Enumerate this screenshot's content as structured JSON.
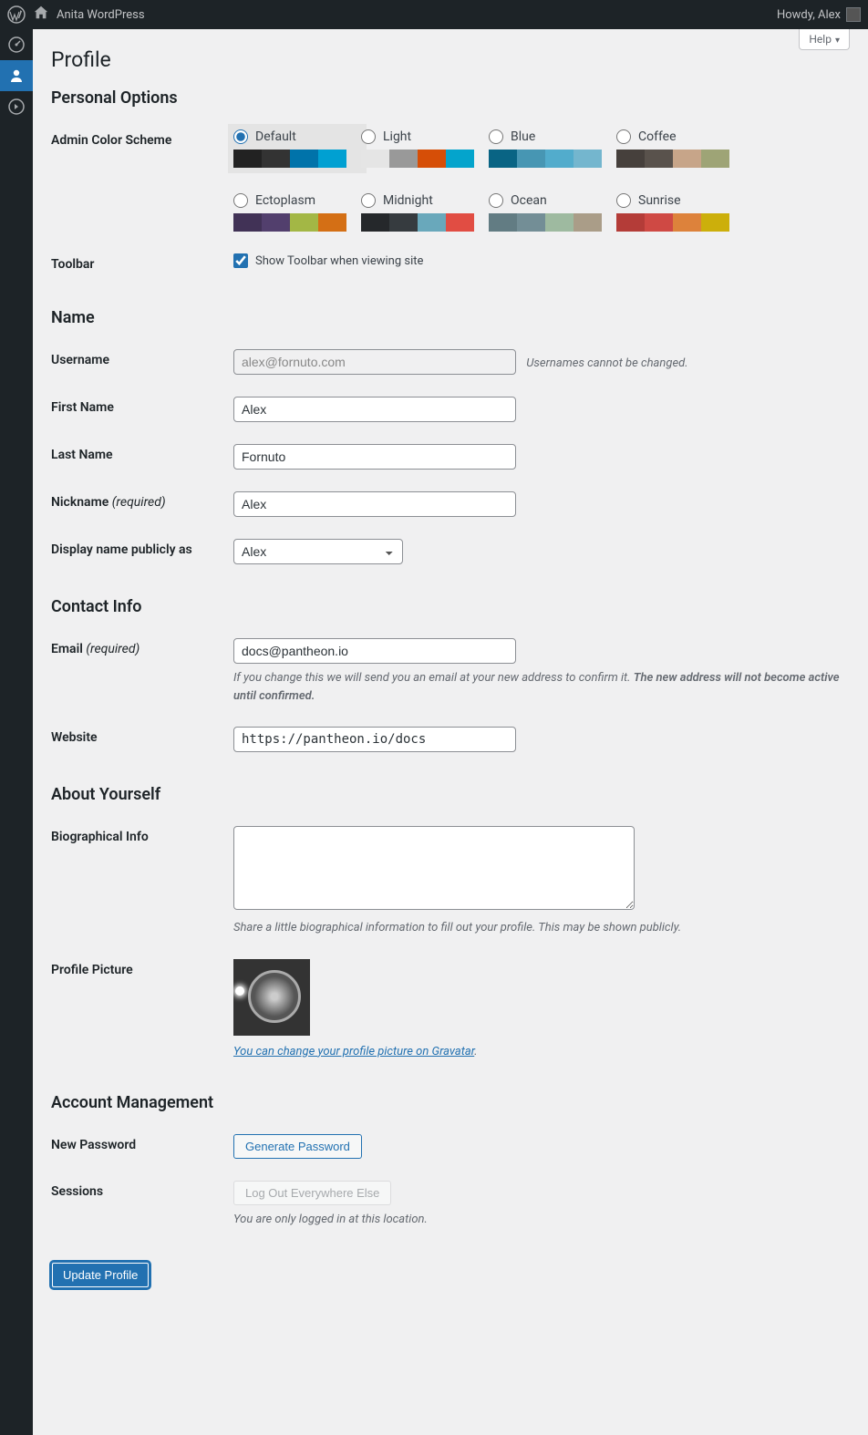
{
  "adminbar": {
    "site_name": "Anita WordPress",
    "howdy": "Howdy, Alex"
  },
  "screen": {
    "help": "Help"
  },
  "page_title": "Profile",
  "sections": {
    "personal_options": "Personal Options",
    "name": "Name",
    "contact_info": "Contact Info",
    "about_yourself": "About Yourself",
    "account_mgmt": "Account Management"
  },
  "labels": {
    "admin_color_scheme": "Admin Color Scheme",
    "toolbar": "Toolbar",
    "toolbar_cb": "Show Toolbar when viewing site",
    "username": "Username",
    "username_note": "Usernames cannot be changed.",
    "first_name": "First Name",
    "last_name": "Last Name",
    "nickname": "Nickname",
    "required": "(required)",
    "display_name": "Display name publicly as",
    "email": "Email",
    "email_note_a": "If you change this we will send you an email at your new address to confirm it.",
    "email_note_b": "The new address will not become active until confirmed.",
    "website": "Website",
    "bio": "Biographical Info",
    "bio_note": "Share a little biographical information to fill out your profile. This may be shown publicly.",
    "profile_picture": "Profile Picture",
    "gravatar_link": "You can change your profile picture on Gravatar",
    "new_password": "New Password",
    "sessions": "Sessions",
    "sessions_note": "You are only logged in at this location."
  },
  "buttons": {
    "generate_password": "Generate Password",
    "logout_everywhere": "Log Out Everywhere Else",
    "update_profile": "Update Profile"
  },
  "values": {
    "username": "alex@fornuto.com",
    "first_name": "Alex",
    "last_name": "Fornuto",
    "nickname": "Alex",
    "display_name": "Alex",
    "email": "docs@pantheon.io",
    "website": "https://pantheon.io/docs",
    "bio": ""
  },
  "schemes": [
    {
      "name": "Default",
      "selected": true,
      "colors": [
        "#222222",
        "#333333",
        "#0073aa",
        "#00a0d2"
      ]
    },
    {
      "name": "Light",
      "selected": false,
      "colors": [
        "#e5e5e5",
        "#999999",
        "#d64e07",
        "#04a4cc"
      ]
    },
    {
      "name": "Blue",
      "selected": false,
      "colors": [
        "#096484",
        "#4796b3",
        "#52accc",
        "#74b6ce"
      ]
    },
    {
      "name": "Coffee",
      "selected": false,
      "colors": [
        "#46403c",
        "#59524c",
        "#c7a589",
        "#9ea476"
      ]
    },
    {
      "name": "Ectoplasm",
      "selected": false,
      "colors": [
        "#413256",
        "#523f6d",
        "#a3b745",
        "#d46f15"
      ]
    },
    {
      "name": "Midnight",
      "selected": false,
      "colors": [
        "#25282b",
        "#363b3f",
        "#69a8bb",
        "#e14d43"
      ]
    },
    {
      "name": "Ocean",
      "selected": false,
      "colors": [
        "#627c83",
        "#738e96",
        "#9ebaa0",
        "#aa9d88"
      ]
    },
    {
      "name": "Sunrise",
      "selected": false,
      "colors": [
        "#b43c38",
        "#cf4944",
        "#dd823b",
        "#ccaf0b"
      ]
    }
  ]
}
